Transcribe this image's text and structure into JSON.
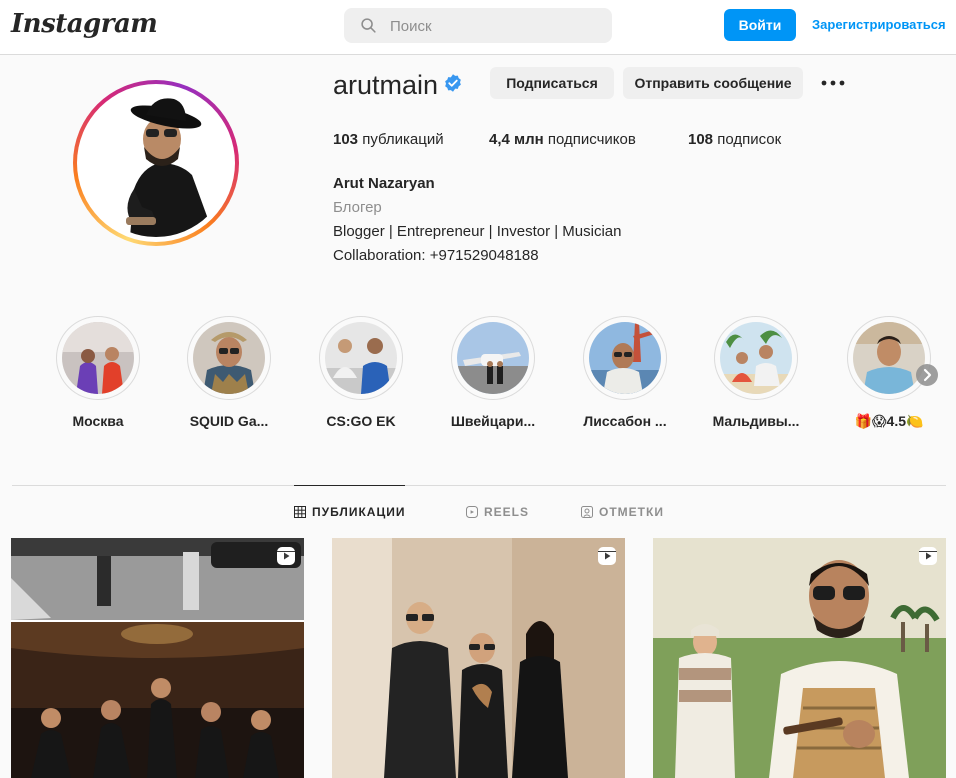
{
  "nav": {
    "logo": "Instagram",
    "search_placeholder": "Поиск",
    "login_label": "Войти",
    "signup_label": "Зарегистрироваться"
  },
  "profile": {
    "username": "arutmain",
    "verified": true,
    "follow_label": "Подписаться",
    "message_label": "Отправить сообщение",
    "stats": {
      "posts_count": "103",
      "posts_label": "публикаций",
      "followers_count": "4,4 млн",
      "followers_label": "подписчиков",
      "following_count": "108",
      "following_label": "подписок"
    },
    "full_name": "Arut Nazaryan",
    "category": "Блогер",
    "bio_line1": "Blogger | Entrepreneur | Investor | Musician",
    "bio_line2": "Collaboration: +971529048188"
  },
  "highlights": [
    {
      "label": "Москва"
    },
    {
      "label": "SQUID Ga..."
    },
    {
      "label": "CS:GO EK"
    },
    {
      "label": "Швейцари..."
    },
    {
      "label": "Лиссабон ..."
    },
    {
      "label": "Мальдивы..."
    },
    {
      "label": "🎁😱4.5🍋"
    }
  ],
  "tabs": {
    "posts": "ПУБЛИКАЦИИ",
    "reels": "REELS",
    "tagged": "ОТМЕТКИ"
  },
  "colors": {
    "accent": "#0095f6",
    "verified": "#3897f0",
    "background": "#fafafa"
  }
}
